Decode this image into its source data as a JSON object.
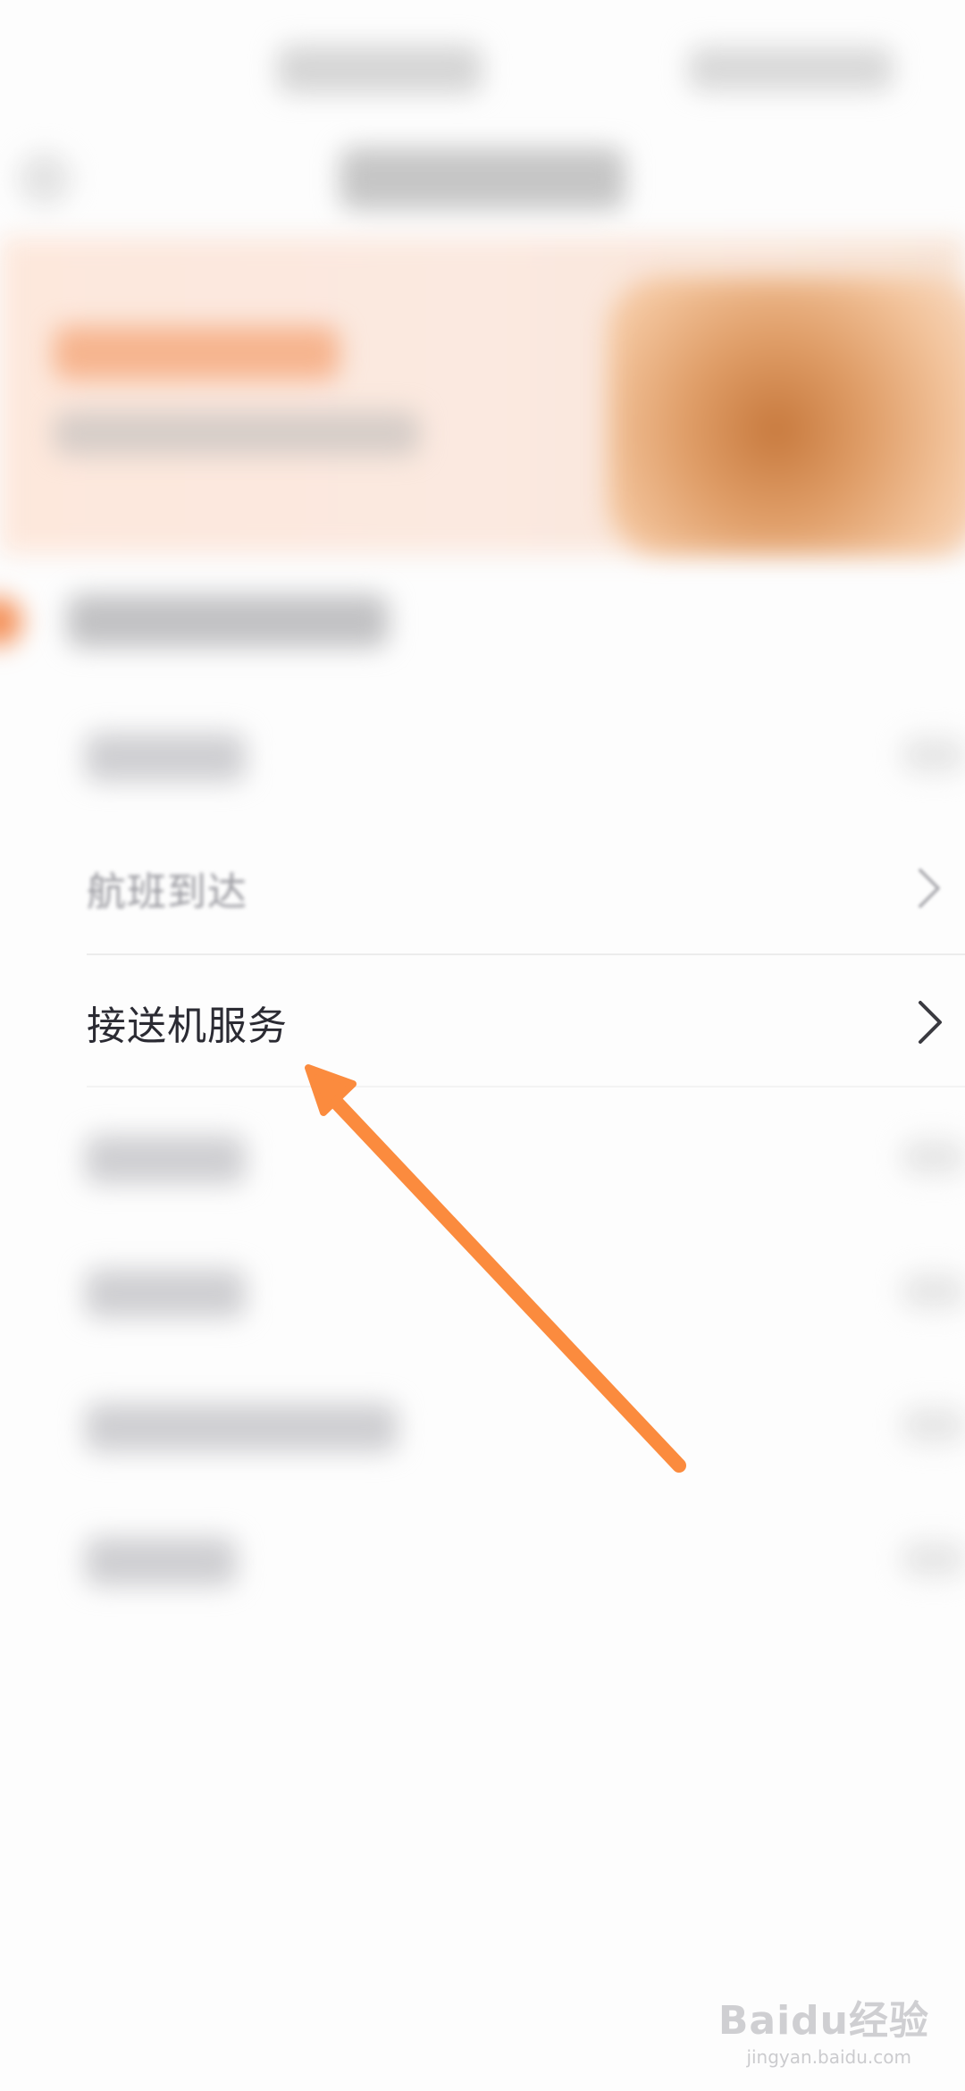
{
  "menu": {
    "flight_arrival": "航班到达",
    "pickup_service": "接送机服务"
  },
  "watermark": {
    "logo_text": "Baidu经验",
    "site": "jingyan.baidu.com"
  },
  "colors": {
    "arrow": "#fb8b3e",
    "banner_bg": "#fbe8de",
    "accent": "#f49058"
  },
  "icons": {
    "chevron": "chevron-right-icon",
    "arrow": "pointer-arrow-icon"
  }
}
